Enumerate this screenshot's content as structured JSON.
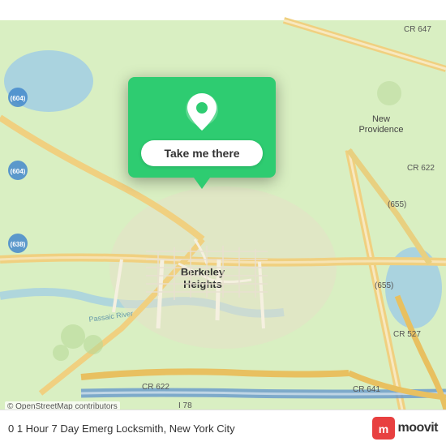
{
  "map": {
    "attribution": "© OpenStreetMap contributors",
    "center_label": "Berkeley Heights",
    "road_labels": [
      "CR 647",
      "CR 622",
      "CR 527",
      "CR 641",
      "CR 622",
      "I 78",
      "(604)",
      "(604)",
      "(638)",
      "(655)",
      "(655)"
    ],
    "river_label": "Passaic River",
    "city_label": "New Providence"
  },
  "popup": {
    "button_label": "Take me there",
    "pin_icon": "location-pin"
  },
  "bottom_bar": {
    "title": "0 1 Hour 7 Day Emerg Locksmith, New York City",
    "logo_text": "moovit"
  },
  "colors": {
    "map_green": "#c8e6a0",
    "map_light_green": "#d9efc2",
    "map_water": "#aad3df",
    "road_yellow": "#f5e9a0",
    "road_white": "#ffffff",
    "popup_green": "#2ecc71",
    "moovit_red": "#e84040"
  }
}
